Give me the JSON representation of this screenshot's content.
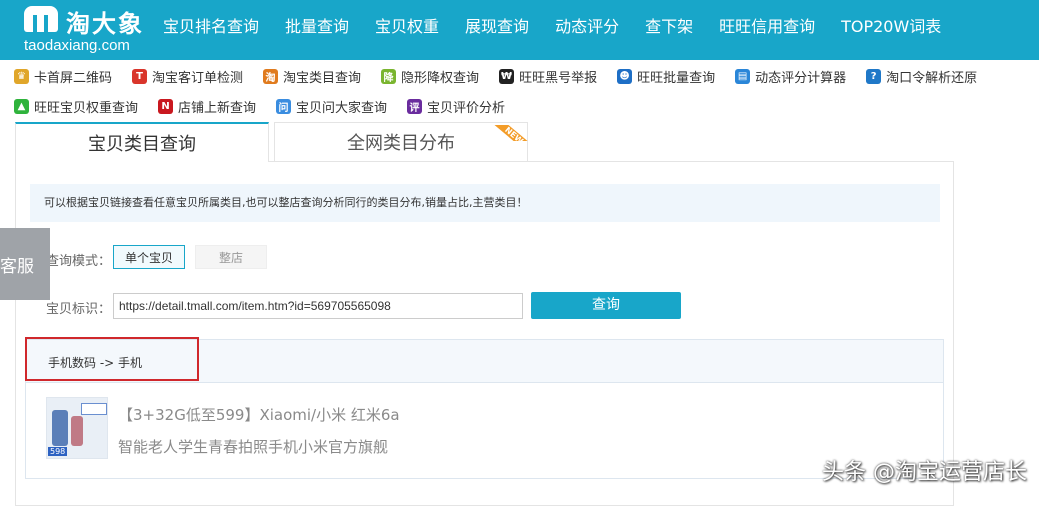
{
  "brand": {
    "name_cn": "淘大象",
    "domain": "taodaxiang.com"
  },
  "nav": [
    "宝贝排名查询",
    "批量查询",
    "宝贝权重",
    "展现查询",
    "动态评分",
    "查下架",
    "旺旺信用查询",
    "TOP20W词表"
  ],
  "tools_row1": [
    {
      "label": "卡首屏二维码",
      "icon": "crown-icon",
      "color": "#e0a62a",
      "glyph": "♛"
    },
    {
      "label": "淘宝客订单检测",
      "icon": "taobao-t-icon",
      "color": "#d9352b",
      "glyph": "T"
    },
    {
      "label": "淘宝类目查询",
      "icon": "tao-icon",
      "color": "#e07b1e",
      "glyph": "淘"
    },
    {
      "label": "隐形降权查询",
      "icon": "down-icon",
      "color": "#7ab52f",
      "glyph": "降"
    },
    {
      "label": "旺旺黑号举报",
      "icon": "blackid-icon",
      "color": "#222222",
      "glyph": "₩"
    },
    {
      "label": "旺旺批量查询",
      "icon": "wangwang-icon",
      "color": "#1e6fc6",
      "glyph": "☻"
    },
    {
      "label": "动态评分计算器",
      "icon": "calculator-icon",
      "color": "#2a86d8",
      "glyph": "▤"
    },
    {
      "label": "淘口令解析还原",
      "icon": "key-icon",
      "color": "#1f78c8",
      "glyph": "?"
    }
  ],
  "tools_row2": [
    {
      "label": "旺旺宝贝权重查询",
      "icon": "bag-icon",
      "color": "#2fb33c",
      "glyph": "▲"
    },
    {
      "label": "店铺上新查询",
      "icon": "new-icon",
      "color": "#c9181f",
      "glyph": "N"
    },
    {
      "label": "宝贝问大家查询",
      "icon": "ask-icon",
      "color": "#3a8de0",
      "glyph": "问"
    },
    {
      "label": "宝贝评价分析",
      "icon": "review-icon",
      "color": "#6a2c9e",
      "glyph": "评"
    }
  ],
  "tabs": {
    "active": "宝贝类目查询",
    "inactive": "全网类目分布",
    "new_badge": "NEW"
  },
  "notice": "可以根据宝贝链接查看任意宝贝所属类目,也可以整店查询分析同行的类目分布,销量占比,主营类目！",
  "form": {
    "mode_label": "查询模式：",
    "mode_single": "单个宝贝",
    "mode_shop": "整店",
    "id_label": "宝贝标识：",
    "url_value": "https://detail.tmall.com/item.htm?id=569705565098",
    "query_button": "查询"
  },
  "result": {
    "category_path": "手机数码 -> 手机",
    "title": "【3+32G低至599】Xiaomi/小米 红米6a",
    "subtitle": "智能老人学生青春拍照手机小米官方旗舰",
    "thumb_price": "598"
  },
  "side": {
    "kefu": "客服"
  },
  "watermark": "头条 @淘宝运营店长",
  "colors": {
    "primary": "#18a6c9",
    "highlight": "#d0282c",
    "new": "#f39c28"
  }
}
